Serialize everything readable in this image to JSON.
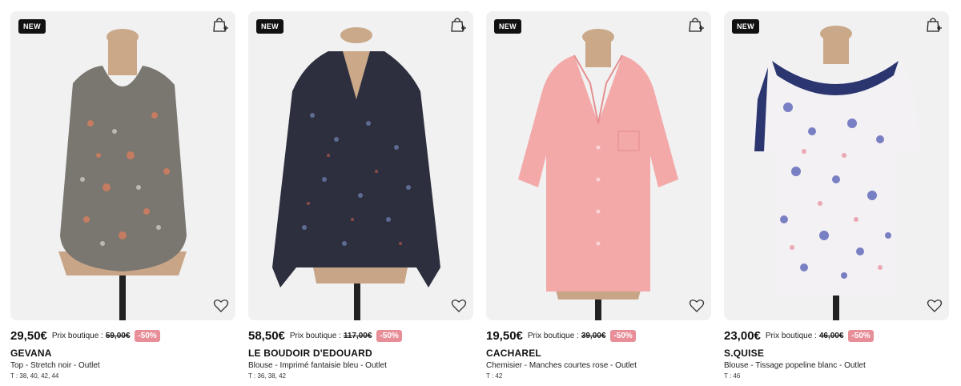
{
  "products": [
    {
      "badge": "NEW",
      "price": "29,50€",
      "ref_label": "Prix boutique :",
      "ref_price": "59,00€",
      "discount": "-50%",
      "brand": "GEVANA",
      "description": "Top - Stretch noir - Outlet",
      "sizes": "T : 38, 40, 42, 44",
      "icons": {
        "bag": "shopping-bag-plus-icon",
        "heart": "heart-icon"
      }
    },
    {
      "badge": "NEW",
      "price": "58,50€",
      "ref_label": "Prix boutique :",
      "ref_price": "117,00€",
      "discount": "-50%",
      "brand": "LE BOUDOIR D'EDOUARD",
      "description": "Blouse - Imprimé fantaisie bleu - Outlet",
      "sizes": "T : 36, 38, 42",
      "icons": {
        "bag": "shopping-bag-plus-icon",
        "heart": "heart-icon"
      }
    },
    {
      "badge": "NEW",
      "price": "19,50€",
      "ref_label": "Prix boutique :",
      "ref_price": "39,00€",
      "discount": "-50%",
      "brand": "CACHAREL",
      "description": "Chemisier - Manches courtes rose - Outlet",
      "sizes": "T : 42",
      "icons": {
        "bag": "shopping-bag-plus-icon",
        "heart": "heart-icon"
      }
    },
    {
      "badge": "NEW",
      "price": "23,00€",
      "ref_label": "Prix boutique :",
      "ref_price": "46,00€",
      "discount": "-50%",
      "brand": "S.QUISE",
      "description": "Blouse - Tissage popeline blanc - Outlet",
      "sizes": "T : 46",
      "icons": {
        "bag": "shopping-bag-plus-icon",
        "heart": "heart-icon"
      }
    }
  ],
  "colors": {
    "discount_bg": "#e88e99",
    "card_bg": "#f1f1f1",
    "badge_bg": "#111111"
  }
}
